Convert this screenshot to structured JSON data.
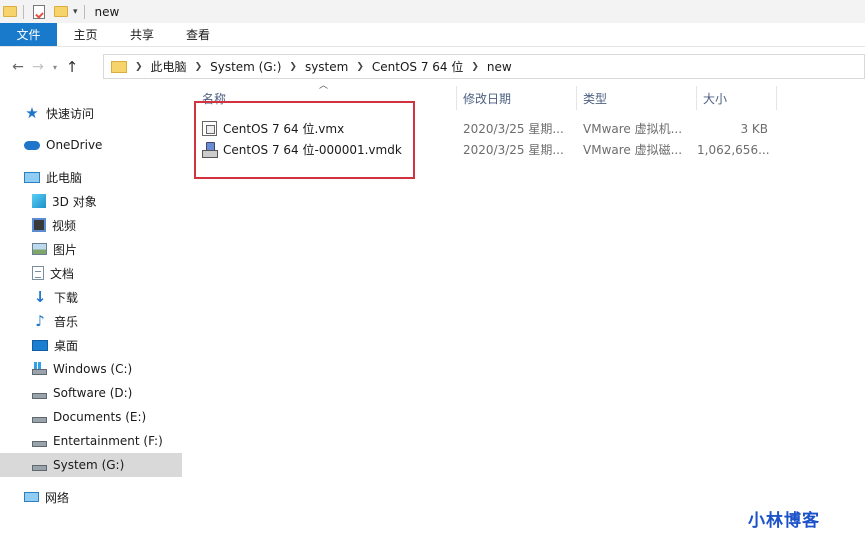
{
  "window": {
    "title": "new"
  },
  "quick_access_toolbar": {
    "icons": [
      "folder-icon",
      "properties-icon",
      "new-folder-icon",
      "customize-dropdown-icon"
    ]
  },
  "ribbon": {
    "tabs": [
      "文件",
      "主页",
      "共享",
      "查看"
    ],
    "active": "文件",
    "accent_color": "#1979ca"
  },
  "address_bar": {
    "crumbs": [
      "此电脑",
      "System (G:)",
      "system",
      "CentOS 7 64 位",
      "new"
    ]
  },
  "nav_pane": {
    "items": [
      {
        "label": "快速访问",
        "icon": "star-icon"
      },
      {
        "label": "OneDrive",
        "icon": "cloud-icon"
      },
      {
        "label": "此电脑",
        "icon": "pc-icon"
      },
      {
        "label": "3D 对象",
        "icon": "3d-objects-icon"
      },
      {
        "label": "视频",
        "icon": "video-icon"
      },
      {
        "label": "图片",
        "icon": "pictures-icon"
      },
      {
        "label": "文档",
        "icon": "documents-icon"
      },
      {
        "label": "下载",
        "icon": "download-icon"
      },
      {
        "label": "音乐",
        "icon": "music-icon"
      },
      {
        "label": "桌面",
        "icon": "desktop-icon"
      },
      {
        "label": "Windows (C:)",
        "icon": "windows-drive-icon"
      },
      {
        "label": "Software (D:)",
        "icon": "drive-icon"
      },
      {
        "label": "Documents (E:)",
        "icon": "drive-icon"
      },
      {
        "label": "Entertainment (F:)",
        "icon": "drive-icon"
      },
      {
        "label": "System (G:)",
        "icon": "drive-icon",
        "selected": true
      },
      {
        "label": "网络",
        "icon": "network-icon"
      }
    ]
  },
  "file_list": {
    "columns": [
      "名称",
      "修改日期",
      "类型",
      "大小"
    ],
    "rows": [
      {
        "name": "CentOS 7 64 位.vmx",
        "date": "2020/3/25 星期...",
        "type": "VMware 虚拟机...",
        "size": "3 KB",
        "icon": "vmx-file-icon"
      },
      {
        "name": "CentOS 7 64 位-000001.vmdk",
        "date": "2020/3/25 星期...",
        "type": "VMware 虚拟磁...",
        "size": "1,062,656...",
        "icon": "vmdk-file-icon"
      }
    ],
    "highlight_color": "#d1343e"
  },
  "watermark": {
    "text": "小林博客",
    "color": "#1a52c9"
  }
}
